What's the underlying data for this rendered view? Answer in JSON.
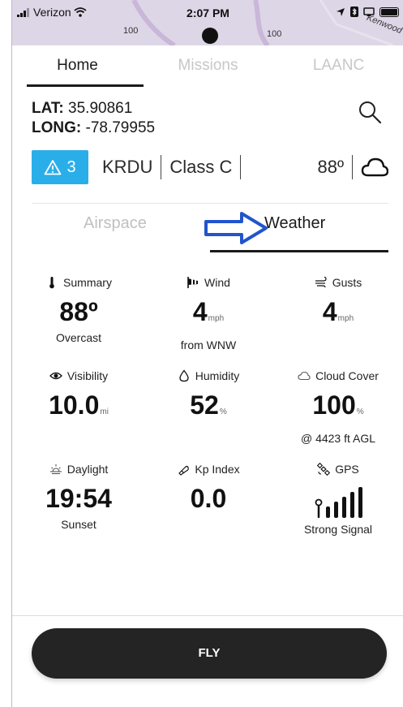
{
  "status_bar": {
    "carrier": "Verizon",
    "time": "2:07 PM",
    "map_labels": [
      "100",
      "100",
      "Kenwood"
    ]
  },
  "tabs": [
    {
      "label": "Home",
      "active": true
    },
    {
      "label": "Missions",
      "active": false
    },
    {
      "label": "LAANC",
      "active": false
    }
  ],
  "location": {
    "lat_label": "LAT:",
    "lat_value": "35.90861",
    "long_label": "LONG:",
    "long_value": "-78.79955"
  },
  "info": {
    "alert_count": "3",
    "airport": "KRDU",
    "airspace_class": "Class C",
    "temperature": "88º",
    "weather_icon": "cloud-icon",
    "alert_color": "#2aaee9"
  },
  "sub_tabs": {
    "airspace": "Airspace",
    "weather": "Weather"
  },
  "weather": {
    "summary": {
      "label": "Summary",
      "value": "88º",
      "unit": "",
      "sub": "Overcast",
      "icon": "thermometer-icon"
    },
    "wind": {
      "label": "Wind",
      "value": "4",
      "unit": "mph",
      "sub": "from WNW",
      "icon": "windsock-icon"
    },
    "gusts": {
      "label": "Gusts",
      "value": "4",
      "unit": "mph",
      "sub": "",
      "icon": "gust-icon"
    },
    "visibility": {
      "label": "Visibility",
      "value": "10.0",
      "unit": "mi",
      "sub": "",
      "icon": "eye-icon"
    },
    "humidity": {
      "label": "Humidity",
      "value": "52",
      "unit": "%",
      "sub": "",
      "icon": "droplet-icon"
    },
    "cloud_cover": {
      "label": "Cloud Cover",
      "value": "100",
      "unit": "%",
      "sub": "@ 4423 ft AGL",
      "icon": "cloud-icon"
    },
    "daylight": {
      "label": "Daylight",
      "value": "19:54",
      "unit": "",
      "sub": "Sunset",
      "icon": "sunset-icon"
    },
    "kp_index": {
      "label": "Kp Index",
      "value": "0.0",
      "unit": "",
      "sub": "",
      "icon": "magnet-icon"
    },
    "gps": {
      "label": "GPS",
      "sub": "Strong Signal",
      "icon": "satellite-icon",
      "signal_level": 5,
      "signal_max": 5
    }
  },
  "fly_button": "FLY",
  "colors": {
    "accent": "#2aaee9",
    "annotation_arrow": "#2255cc",
    "button_bg": "#242424"
  }
}
